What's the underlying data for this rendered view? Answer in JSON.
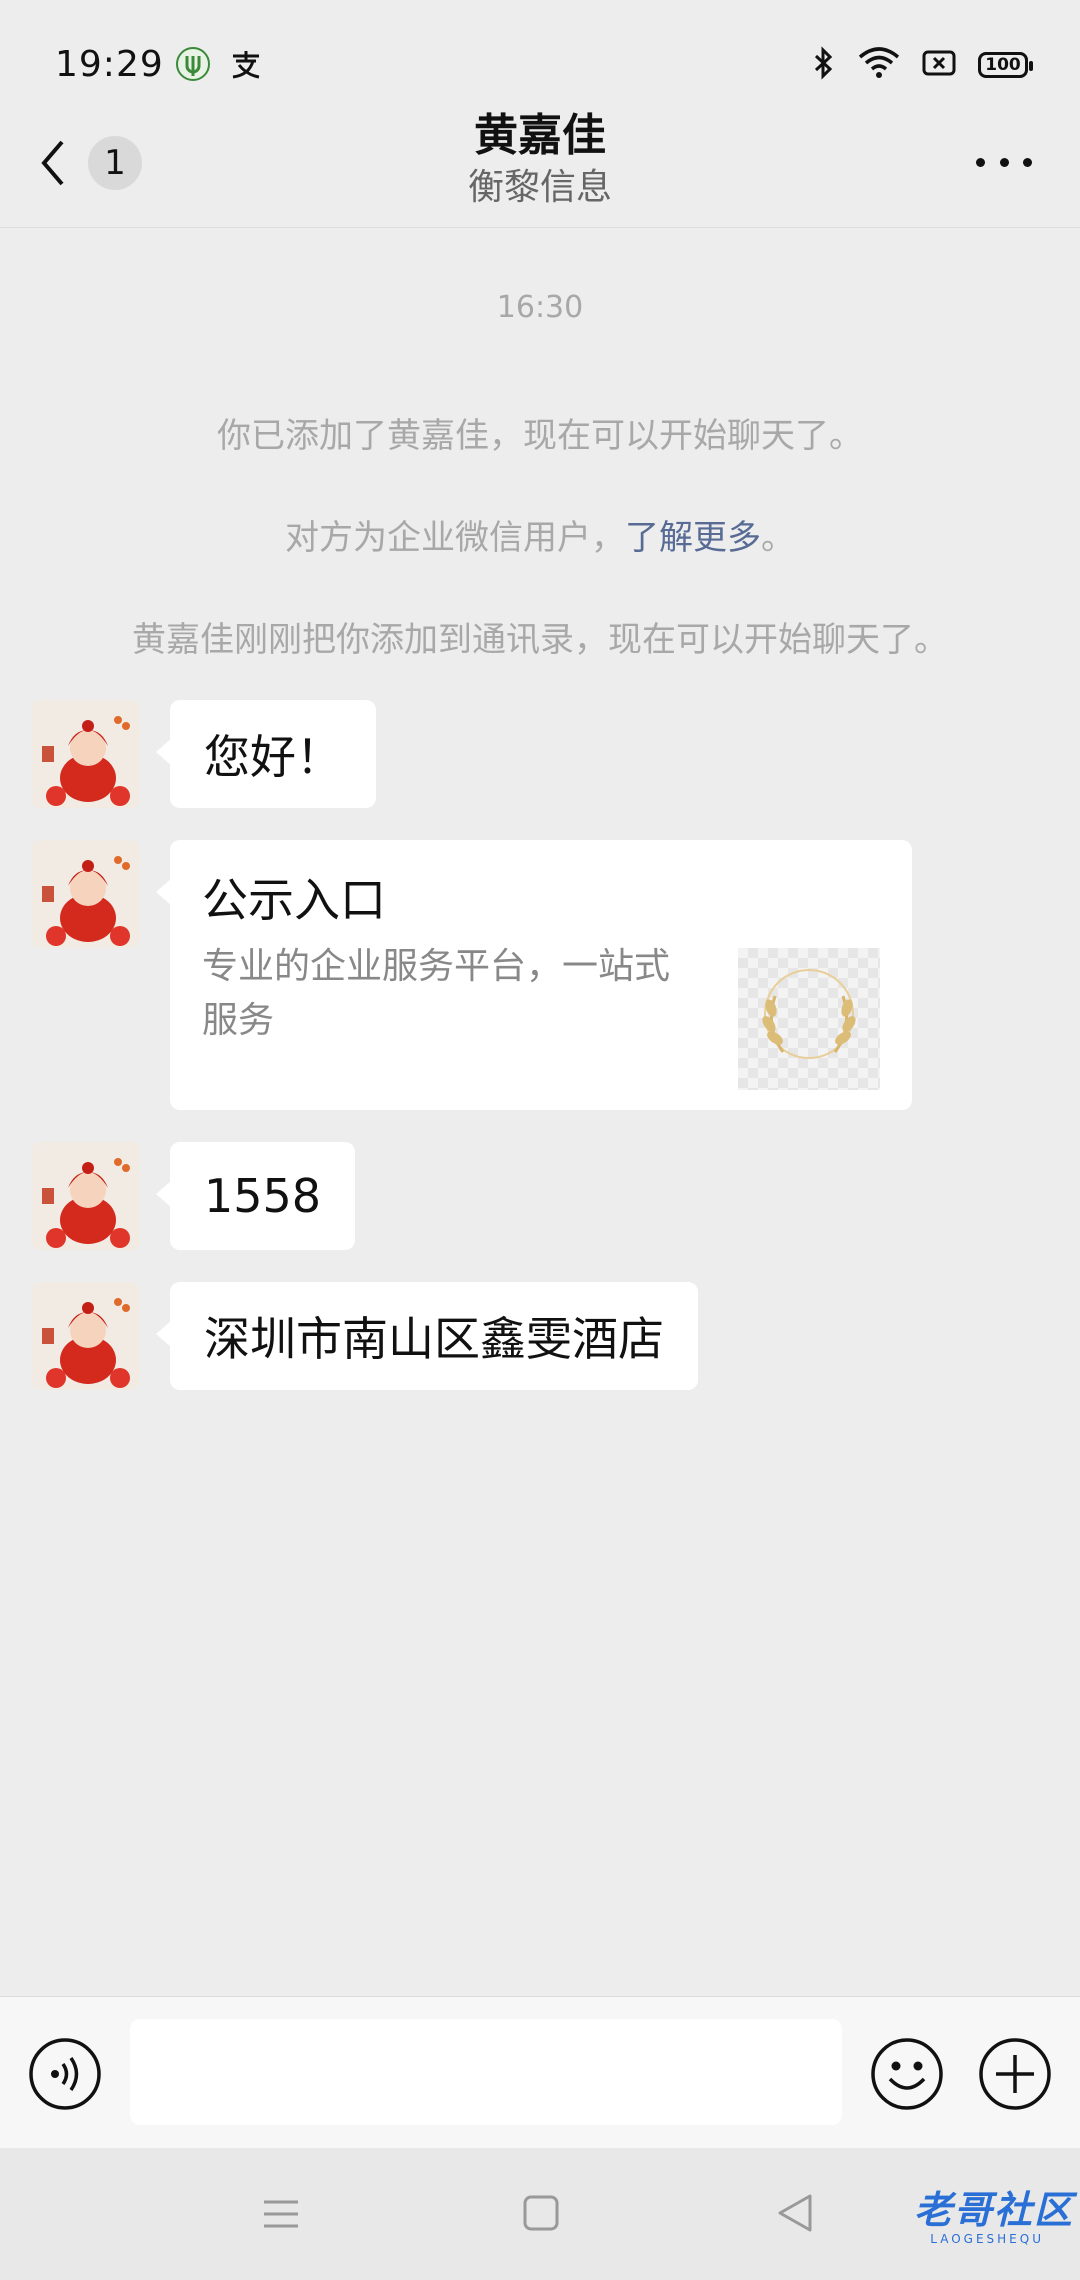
{
  "status_bar": {
    "time": "19:29",
    "battery": "100",
    "icons": [
      "app-notification-icon",
      "alipay-icon",
      "bluetooth-icon",
      "wifi-icon",
      "sim-icon",
      "battery-icon"
    ]
  },
  "header": {
    "unread_count": "1",
    "title": "黄嘉佳",
    "subtitle": "衡黎信息"
  },
  "system_messages": {
    "time": "16:30",
    "added": "你已添加了黄嘉佳，现在可以开始聊天了。",
    "enterprise_prefix": "对方为企业微信用户，",
    "enterprise_link": "了解更多",
    "enterprise_suffix": "。",
    "contact_added": "黄嘉佳刚刚把你添加到通讯录，现在可以开始聊天了。"
  },
  "messages": [
    {
      "type": "text",
      "text": "您好！"
    },
    {
      "type": "card",
      "title": "公示入口",
      "description": "专业的企业服务平台，一站式服务"
    },
    {
      "type": "text",
      "text": "1558"
    },
    {
      "type": "text",
      "text": "深圳市南山区鑫雯酒店"
    }
  ],
  "input": {
    "value": "",
    "placeholder": ""
  },
  "watermark": {
    "main": "老哥社区",
    "sub": "LAOGESHEQU"
  },
  "colors": {
    "background": "#ededed",
    "bubble": "#ffffff",
    "link": "#576b95",
    "system_text": "#a8a8a8",
    "watermark": "#2a6fd6"
  }
}
